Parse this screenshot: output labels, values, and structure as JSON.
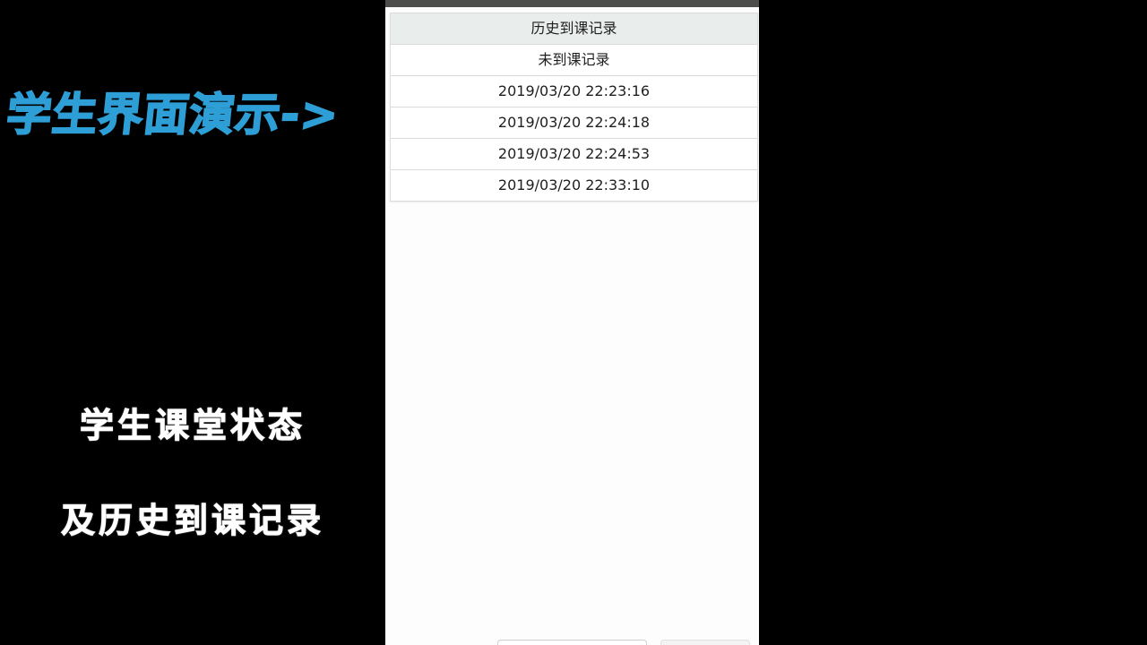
{
  "overlay": {
    "title": "学生界面演示->",
    "subtitle_line1": "学生课堂状态",
    "subtitle_line2": "及历史到课记录"
  },
  "table": {
    "header": "历史到课记录",
    "rows": [
      "未到课记录",
      "2019/03/20 22:23:16",
      "2019/03/20 22:24:18",
      "2019/03/20 22:24:53",
      "2019/03/20 22:33:10"
    ]
  },
  "colors": {
    "title_accent": "#2e9fd6",
    "phone_background": "#fcfdfc",
    "header_row_background": "#e9eeec",
    "status_strip": "#4d4e4b"
  }
}
